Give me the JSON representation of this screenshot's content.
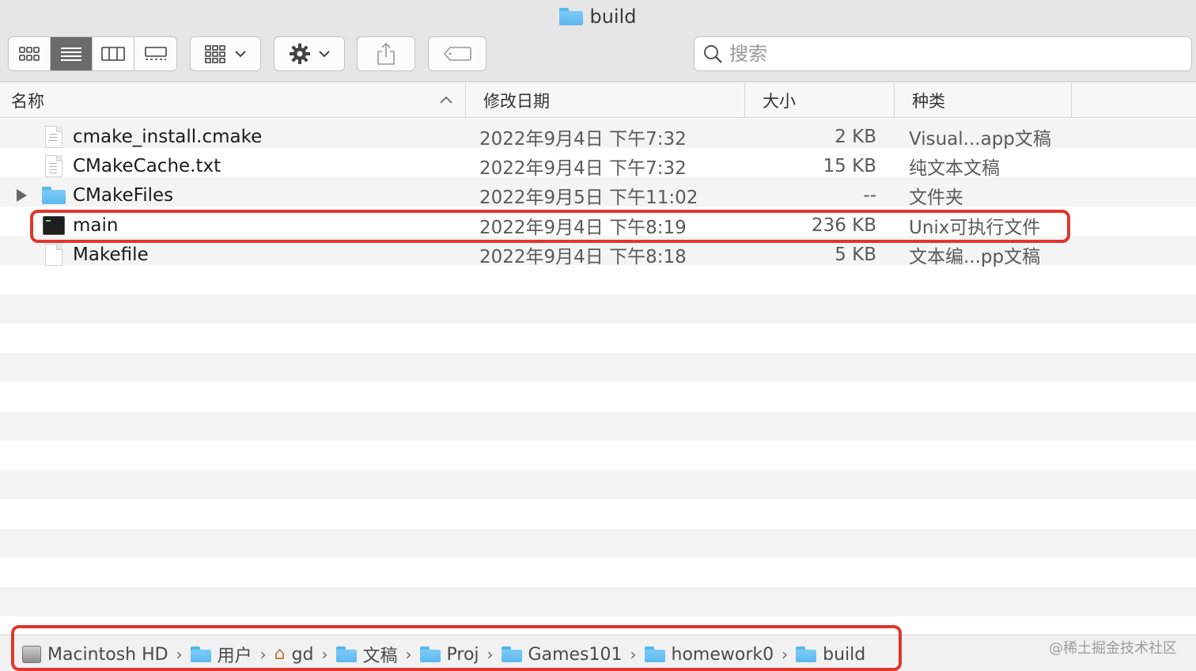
{
  "window": {
    "title": "build"
  },
  "toolbar": {
    "views": [
      {
        "name": "icon-view",
        "icon": "grid-icon",
        "active": false
      },
      {
        "name": "list-view",
        "icon": "list-icon",
        "active": true
      },
      {
        "name": "column-view",
        "icon": "columns-icon",
        "active": false
      },
      {
        "name": "gallery-view",
        "icon": "gallery-icon",
        "active": false
      }
    ],
    "search_placeholder": "搜索"
  },
  "columns": {
    "name": "名称",
    "date": "修改日期",
    "size": "大小",
    "kind": "种类"
  },
  "files": [
    {
      "name": "cmake_install.cmake",
      "date": "2022年9月4日 下午7:32",
      "size": "2 KB",
      "kind": "Visual...app文稿",
      "icon": "document-icon",
      "expandable": false
    },
    {
      "name": "CMakeCache.txt",
      "date": "2022年9月4日 下午7:32",
      "size": "15 KB",
      "kind": "纯文本文稿",
      "icon": "text-document-icon",
      "expandable": false
    },
    {
      "name": "CMakeFiles",
      "date": "2022年9月5日 下午11:02",
      "size": "--",
      "kind": "文件夹",
      "icon": "folder-icon",
      "expandable": true
    },
    {
      "name": "main",
      "date": "2022年9月4日 下午8:19",
      "size": "236 KB",
      "kind": "Unix可执行文件",
      "icon": "executable-icon",
      "expandable": false,
      "highlighted": true
    },
    {
      "name": "Makefile",
      "date": "2022年9月4日 下午8:18",
      "size": "5 KB",
      "kind": "文本编...pp文稿",
      "icon": "blank-document-icon",
      "expandable": false
    }
  ],
  "pathbar": {
    "crumbs": [
      "Macintosh HD",
      "用户",
      "gd",
      "文稿",
      "Proj",
      "Games101",
      "homework0",
      "build"
    ],
    "separator": "›"
  },
  "watermark": "@稀土掘金技术社区",
  "colors": {
    "highlight": "#e0362b",
    "folder": "#5cb7ee",
    "active_view": "#6b6b6b"
  }
}
